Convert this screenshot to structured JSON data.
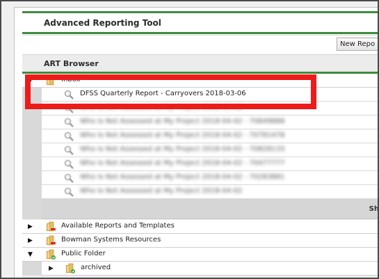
{
  "app": {
    "title": "Advanced Reporting Tool",
    "new_report_button": "New Repo"
  },
  "browser": {
    "title": "ART Browser",
    "inbox": {
      "label": "Inbox",
      "toggle": "▼",
      "reports": [
        {
          "label": "DFSS Quarterly Report - Carryovers 2018-03-06",
          "blurred": false
        },
        {
          "label": "Who Is Not Assessed at My Project 2018-04-02",
          "blurred": true
        },
        {
          "label": "Who Is Not Assessed at My Project 2018-04-02 - 70849888",
          "blurred": true
        },
        {
          "label": "Who Is Not Assessed at My Project 2018-04-02 - 70781478",
          "blurred": true
        },
        {
          "label": "Who Is Not Assessed at My Project 2018-04-02 - 70828133",
          "blurred": true
        },
        {
          "label": "Who Is Not Assessed at My Project 2018-04-02 - 70477777",
          "blurred": true
        },
        {
          "label": "Who Is Not Assessed at My Project 2018-04-02 - 70283881",
          "blurred": true
        },
        {
          "label": "Who Is Not Assessed at My Project 2018-04-02",
          "blurred": true
        }
      ],
      "pager_text": "Sh"
    },
    "folders": [
      {
        "label": "Available Reports and Templates",
        "toggle": "▶",
        "icon": "folder-red-arrow-icon"
      },
      {
        "label": "Bowman Systems Resources",
        "toggle": "▶",
        "icon": "folder-red-arrow-icon"
      },
      {
        "label": "Public Folder",
        "toggle": "▼",
        "icon": "folder-green-check-icon"
      }
    ],
    "subfolder": {
      "label": "archived",
      "toggle": "▶",
      "icon": "folder-green-check-icon"
    }
  },
  "colors": {
    "accent_green": "#3d8c3a",
    "highlight_red": "#ee1b1b",
    "folder_tan": "#d4a84c",
    "arrow_red": "#d9261c",
    "check_green": "#3aa63a"
  }
}
